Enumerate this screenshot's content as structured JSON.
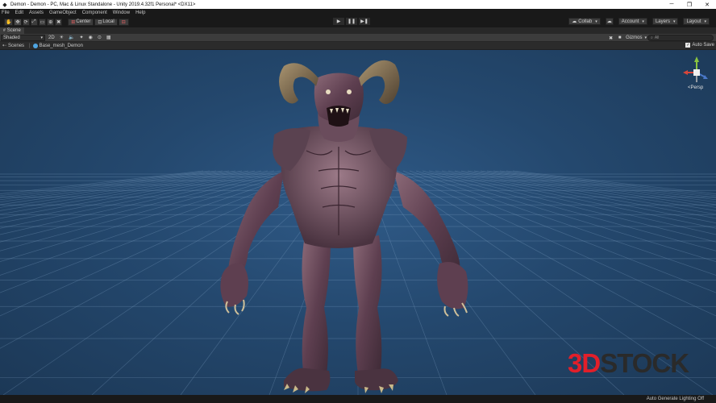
{
  "window": {
    "title": "Demon - Demon - PC, Mac & Linux Standalone - Unity 2019.4.32f1 Personal* <DX11>",
    "controls": {
      "minimize": "─",
      "maximize": "❐",
      "close": "✕"
    }
  },
  "menu": [
    "File",
    "Edit",
    "Assets",
    "GameObject",
    "Component",
    "Window",
    "Help"
  ],
  "toolbar": {
    "tools": [
      {
        "icon": "hand-icon",
        "glyph": "✋"
      },
      {
        "icon": "move-icon",
        "glyph": "✥"
      },
      {
        "icon": "rotate-icon",
        "glyph": "⟳"
      },
      {
        "icon": "scale-icon",
        "glyph": "⤢"
      },
      {
        "icon": "rect-icon",
        "glyph": "▭"
      },
      {
        "icon": "transform-icon",
        "glyph": "⊕"
      },
      {
        "icon": "custom-tool-icon",
        "glyph": "✖"
      }
    ],
    "pivot": "Center",
    "space": "Local",
    "play": "▶",
    "pause": "❚❚",
    "step": "▶❚",
    "collab": "Collab",
    "account": "Account",
    "layers": "Layers",
    "layout": "Layout"
  },
  "scene_tab": {
    "label": "Scene"
  },
  "scene_toolbar": {
    "shading_mode": "Shaded",
    "mode_2d": "2D",
    "gizmos": "Gizmos",
    "search_placeholder": "All"
  },
  "breadcrumb": {
    "root": "Scenes",
    "item": "Base_mesh_Demon"
  },
  "auto_save": {
    "label": "Auto Save",
    "checked": true
  },
  "viewport": {
    "projection": "<Persp",
    "watermark_a": "3D",
    "watermark_b": "STOCK"
  },
  "status": {
    "text": "Auto Generate Lighting Off"
  },
  "colors": {
    "viewport": "#24486e",
    "watermark_red": "#e21f2a",
    "demon_skin": "#6e4a5c",
    "horn": "#7a6a4a"
  }
}
